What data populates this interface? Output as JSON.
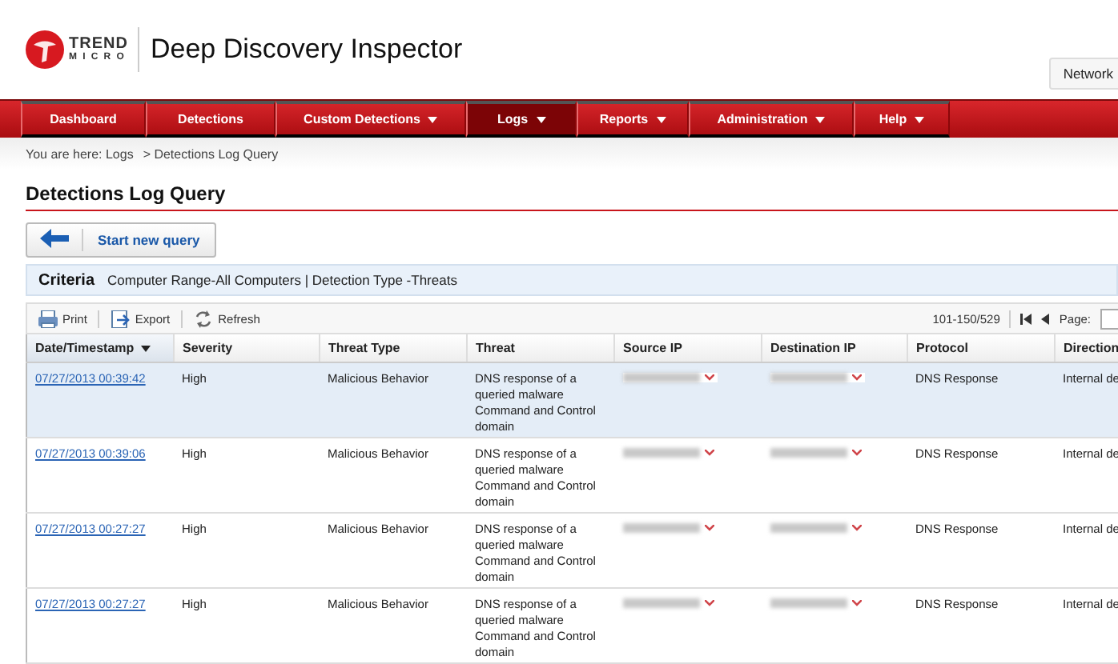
{
  "brand": {
    "logo_top": "TREND",
    "logo_bottom": "MICRO",
    "product": "Deep Discovery Inspector"
  },
  "top_right_button": "Network",
  "nav": [
    {
      "label": "Dashboard",
      "has_menu": false,
      "selected": false
    },
    {
      "label": "Detections",
      "has_menu": false,
      "selected": false
    },
    {
      "label": "Custom Detections",
      "has_menu": true,
      "selected": false
    },
    {
      "label": "Logs",
      "has_menu": true,
      "selected": true
    },
    {
      "label": "Reports",
      "has_menu": true,
      "selected": false
    },
    {
      "label": "Administration",
      "has_menu": true,
      "selected": false
    },
    {
      "label": "Help",
      "has_menu": true,
      "selected": false
    }
  ],
  "breadcrumb": {
    "prefix": "You are here: Logs",
    "current": "> Detections Log Query"
  },
  "page_title": "Detections Log Query",
  "start_button": "Start new query",
  "criteria": {
    "label": "Criteria",
    "text": "Computer Range-All Computers | Detection Type -Threats"
  },
  "toolbar": {
    "actions": [
      {
        "label": "Print",
        "kind": "print"
      },
      {
        "label": "Export",
        "kind": "export"
      },
      {
        "label": "Refresh",
        "kind": "refresh"
      }
    ],
    "paging": "101-150/529",
    "page_label": "Page:"
  },
  "table": {
    "columns": [
      {
        "label": "Date/Timestamp",
        "sorted": true
      },
      {
        "label": "Severity",
        "sorted": false
      },
      {
        "label": "Threat Type",
        "sorted": false
      },
      {
        "label": "Threat",
        "sorted": false
      },
      {
        "label": "Source IP",
        "sorted": false
      },
      {
        "label": "Destination IP",
        "sorted": false
      },
      {
        "label": "Protocol",
        "sorted": false
      },
      {
        "label": "Direction",
        "sorted": false
      }
    ],
    "rows": [
      {
        "selected": true,
        "timestamp": "07/27/2013 00:39:42",
        "severity": "High",
        "threat_type": "Malicious Behavior",
        "threat": "DNS response of a queried malware Command and Control domain",
        "protocol": "DNS Response",
        "direction": "Internal de"
      },
      {
        "selected": false,
        "timestamp": "07/27/2013 00:39:06",
        "severity": "High",
        "threat_type": "Malicious Behavior",
        "threat": "DNS response of a queried malware Command and Control domain",
        "protocol": "DNS Response",
        "direction": "Internal de"
      },
      {
        "selected": false,
        "timestamp": "07/27/2013 00:27:27",
        "severity": "High",
        "threat_type": "Malicious Behavior",
        "threat": "DNS response of a queried malware Command and Control domain",
        "protocol": "DNS Response",
        "direction": "Internal de"
      },
      {
        "selected": false,
        "timestamp": "07/27/2013 00:27:27",
        "severity": "High",
        "threat_type": "Malicious Behavior",
        "threat": "DNS response of a queried malware Command and Control domain",
        "protocol": "DNS Response",
        "direction": "Internal de"
      }
    ]
  }
}
